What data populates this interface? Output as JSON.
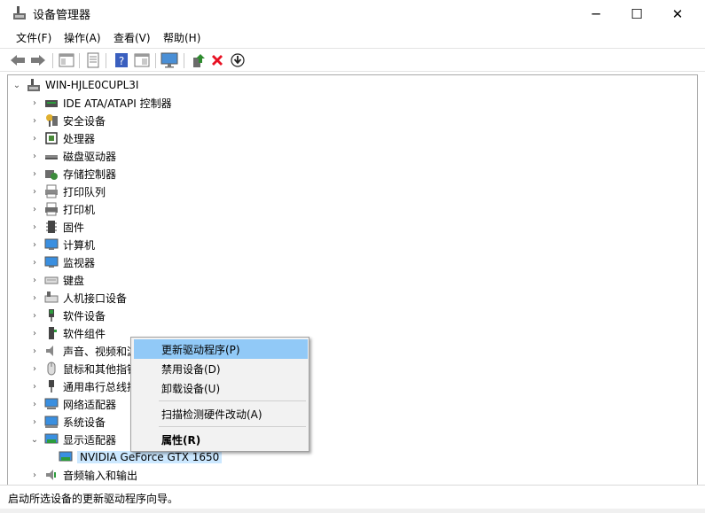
{
  "window": {
    "title": "设备管理器",
    "min_glyph": "─",
    "max_glyph": "☐",
    "close_glyph": "✕"
  },
  "menu": {
    "file": "文件(F)",
    "action": "操作(A)",
    "view": "查看(V)",
    "help": "帮助(H)"
  },
  "toolbar_icons": [
    "back-icon",
    "forward-icon",
    "show-hide-tree-icon",
    "properties-icon",
    "help-icon",
    "view-icon",
    "monitor-icon",
    "update-driver-icon",
    "uninstall-icon",
    "download-icon"
  ],
  "tree": {
    "root": "WIN-HJLE0CUPL3I",
    "items": [
      {
        "label": "IDE ATA/ATAPI 控制器",
        "icon": "ide-controller-icon"
      },
      {
        "label": "安全设备",
        "icon": "security-key-icon"
      },
      {
        "label": "处理器",
        "icon": "processor-icon"
      },
      {
        "label": "磁盘驱动器",
        "icon": "disk-drive-icon"
      },
      {
        "label": "存储控制器",
        "icon": "storage-controller-icon"
      },
      {
        "label": "打印队列",
        "icon": "print-queue-icon"
      },
      {
        "label": "打印机",
        "icon": "printer-icon"
      },
      {
        "label": "固件",
        "icon": "firmware-icon"
      },
      {
        "label": "计算机",
        "icon": "computer-icon"
      },
      {
        "label": "监视器",
        "icon": "monitor-icon"
      },
      {
        "label": "键盘",
        "icon": "keyboard-icon"
      },
      {
        "label": "人机接口设备",
        "icon": "hid-icon"
      },
      {
        "label": "软件设备",
        "icon": "software-device-icon"
      },
      {
        "label": "软件组件",
        "icon": "software-component-icon"
      },
      {
        "label": "声音、视频和游戏控制器",
        "icon": "speaker-icon"
      },
      {
        "label": "鼠标和其他指针设备",
        "icon": "mouse-icon"
      },
      {
        "label": "通用串行总线控制器",
        "icon": "usb-icon"
      },
      {
        "label": "网络适配器",
        "icon": "network-adapter-icon"
      },
      {
        "label": "系统设备",
        "icon": "system-device-icon"
      },
      {
        "label": "显示适配器",
        "icon": "display-adapter-icon"
      },
      {
        "label": "NVIDIA GeForce GTX 1650",
        "icon": "gpu-icon"
      },
      {
        "label": "音频输入和输出",
        "icon": "audio-io-icon"
      }
    ]
  },
  "context_menu": {
    "update_driver": "更新驱动程序(P)",
    "disable_device": "禁用设备(D)",
    "uninstall_device": "卸载设备(U)",
    "scan_hardware": "扫描检测硬件改动(A)",
    "properties": "属性(R)"
  },
  "status": {
    "text": "启动所选设备的更新驱动程序向导。"
  },
  "colors": {
    "selection": "#cce8ff",
    "menu_highlight": "#91c9f7",
    "uninstall_red": "#e81123",
    "update_green": "#2e8b2e"
  }
}
